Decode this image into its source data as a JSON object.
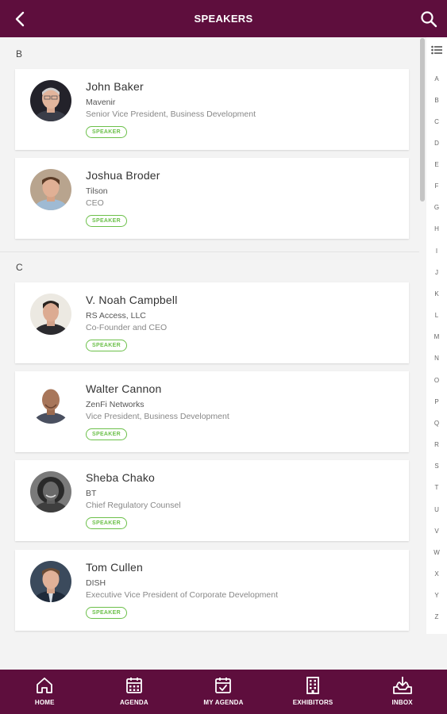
{
  "header": {
    "title": "SPEAKERS"
  },
  "sections": [
    {
      "letter": "B",
      "speakers": [
        {
          "name": "John Baker",
          "company": "Mavenir",
          "role": "Senior Vice President, Business Development",
          "badge": "SPEAKER"
        },
        {
          "name": "Joshua Broder",
          "company": "Tilson",
          "role": "CEO",
          "badge": "SPEAKER"
        }
      ]
    },
    {
      "letter": "C",
      "speakers": [
        {
          "name": "V. Noah Campbell",
          "company": "RS Access, LLC",
          "role": "Co-Founder and CEO",
          "badge": "SPEAKER"
        },
        {
          "name": "Walter Cannon",
          "company": "ZenFi Networks",
          "role": "Vice President, Business Development",
          "badge": "SPEAKER"
        },
        {
          "name": "Sheba Chako",
          "company": "BT",
          "role": "Chief Regulatory Counsel",
          "badge": "SPEAKER"
        },
        {
          "name": "Tom Cullen",
          "company": "DISH",
          "role": "Executive Vice President of Corporate Development",
          "badge": "SPEAKER"
        }
      ]
    }
  ],
  "index": [
    "A",
    "B",
    "C",
    "D",
    "E",
    "F",
    "G",
    "H",
    "I",
    "J",
    "K",
    "L",
    "M",
    "N",
    "O",
    "P",
    "Q",
    "R",
    "S",
    "T",
    "U",
    "V",
    "W",
    "X",
    "Y",
    "Z"
  ],
  "tabs": [
    {
      "label": "HOME",
      "icon": "home-icon"
    },
    {
      "label": "AGENDA",
      "icon": "calendar-icon"
    },
    {
      "label": "MY AGENDA",
      "icon": "calendar-check-icon"
    },
    {
      "label": "EXHIBITORS",
      "icon": "building-icon"
    },
    {
      "label": "INBOX",
      "icon": "inbox-icon"
    }
  ],
  "colors": {
    "brand": "#5e0e3d",
    "badge": "#6cc04a",
    "background": "#f3f3f3"
  }
}
